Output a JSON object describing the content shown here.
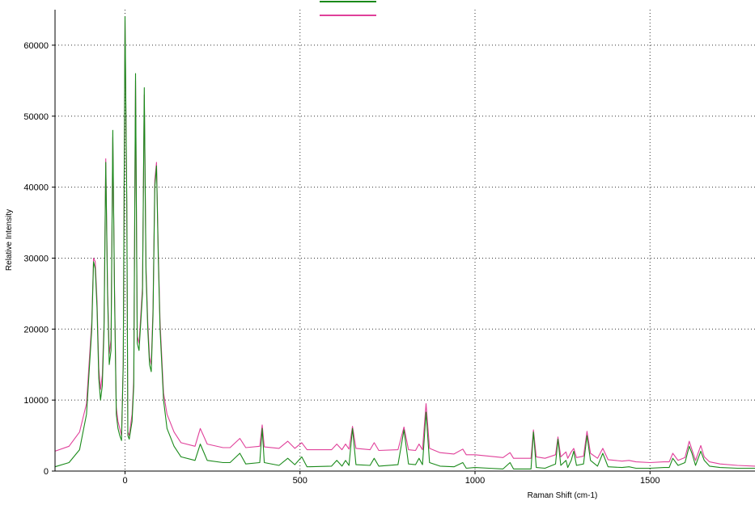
{
  "chart_data": {
    "type": "line",
    "title": "",
    "xlabel": "Raman Shift (cm-1)",
    "ylabel": "Relative Intensity",
    "xlim": [
      -200,
      1800
    ],
    "ylim": [
      0,
      65000
    ],
    "grid": true,
    "grid_style": "dotted",
    "legend_placement": "top-center",
    "x_ticks": [
      0,
      500,
      1000,
      1500
    ],
    "y_ticks": [
      0,
      10000,
      20000,
      30000,
      40000,
      50000,
      60000
    ],
    "series": [
      {
        "color": "#1a8a1a",
        "points": [
          [
            -200,
            600
          ],
          [
            -160,
            1200
          ],
          [
            -130,
            3000
          ],
          [
            -110,
            8000
          ],
          [
            -95,
            20000
          ],
          [
            -90,
            29500
          ],
          [
            -85,
            28500
          ],
          [
            -80,
            23000
          ],
          [
            -75,
            13000
          ],
          [
            -70,
            10000
          ],
          [
            -65,
            12000
          ],
          [
            -60,
            20000
          ],
          [
            -55,
            43500
          ],
          [
            -50,
            25000
          ],
          [
            -45,
            15000
          ],
          [
            -40,
            17000
          ],
          [
            -35,
            48000
          ],
          [
            -30,
            25000
          ],
          [
            -25,
            8000
          ],
          [
            -20,
            6000
          ],
          [
            -15,
            5000
          ],
          [
            -10,
            4300
          ],
          [
            -5,
            15000
          ],
          [
            0,
            64000
          ],
          [
            5,
            38000
          ],
          [
            8,
            5000
          ],
          [
            12,
            4500
          ],
          [
            20,
            7000
          ],
          [
            25,
            12000
          ],
          [
            30,
            56000
          ],
          [
            35,
            18000
          ],
          [
            40,
            17000
          ],
          [
            45,
            21000
          ],
          [
            50,
            25000
          ],
          [
            55,
            54000
          ],
          [
            60,
            28000
          ],
          [
            65,
            20000
          ],
          [
            70,
            15000
          ],
          [
            75,
            14000
          ],
          [
            80,
            22000
          ],
          [
            85,
            40000
          ],
          [
            90,
            43000
          ],
          [
            95,
            30000
          ],
          [
            100,
            20000
          ],
          [
            110,
            10000
          ],
          [
            120,
            6000
          ],
          [
            140,
            3500
          ],
          [
            160,
            2000
          ],
          [
            200,
            1500
          ],
          [
            215,
            3800
          ],
          [
            235,
            1500
          ],
          [
            280,
            1200
          ],
          [
            300,
            1200
          ],
          [
            328,
            2500
          ],
          [
            345,
            1000
          ],
          [
            385,
            1200
          ],
          [
            392,
            6000
          ],
          [
            398,
            1200
          ],
          [
            440,
            800
          ],
          [
            465,
            1800
          ],
          [
            485,
            900
          ],
          [
            505,
            2000
          ],
          [
            520,
            600
          ],
          [
            590,
            700
          ],
          [
            605,
            1500
          ],
          [
            620,
            700
          ],
          [
            630,
            1500
          ],
          [
            640,
            800
          ],
          [
            650,
            6000
          ],
          [
            660,
            900
          ],
          [
            700,
            800
          ],
          [
            712,
            1800
          ],
          [
            725,
            700
          ],
          [
            780,
            900
          ],
          [
            797,
            5800
          ],
          [
            810,
            1000
          ],
          [
            830,
            900
          ],
          [
            840,
            1800
          ],
          [
            850,
            900
          ],
          [
            860,
            8300
          ],
          [
            870,
            1200
          ],
          [
            900,
            700
          ],
          [
            940,
            600
          ],
          [
            965,
            1200
          ],
          [
            975,
            400
          ],
          [
            1000,
            500
          ],
          [
            1040,
            400
          ],
          [
            1080,
            300
          ],
          [
            1100,
            1200
          ],
          [
            1110,
            300
          ],
          [
            1160,
            300
          ],
          [
            1167,
            5500
          ],
          [
            1175,
            500
          ],
          [
            1200,
            400
          ],
          [
            1230,
            1000
          ],
          [
            1237,
            4500
          ],
          [
            1245,
            800
          ],
          [
            1260,
            1500
          ],
          [
            1265,
            500
          ],
          [
            1275,
            1500
          ],
          [
            1282,
            2800
          ],
          [
            1290,
            800
          ],
          [
            1310,
            1000
          ],
          [
            1320,
            5000
          ],
          [
            1330,
            1500
          ],
          [
            1350,
            700
          ],
          [
            1365,
            2500
          ],
          [
            1380,
            600
          ],
          [
            1420,
            500
          ],
          [
            1440,
            600
          ],
          [
            1460,
            400
          ],
          [
            1500,
            400
          ],
          [
            1540,
            500
          ],
          [
            1555,
            500
          ],
          [
            1565,
            1800
          ],
          [
            1580,
            800
          ],
          [
            1600,
            1200
          ],
          [
            1612,
            3500
          ],
          [
            1620,
            2500
          ],
          [
            1630,
            800
          ],
          [
            1645,
            2800
          ],
          [
            1655,
            1500
          ],
          [
            1670,
            700
          ],
          [
            1700,
            500
          ],
          [
            1750,
            400
          ],
          [
            1800,
            400
          ]
        ]
      },
      {
        "color": "#e0409a",
        "points": [
          [
            -200,
            2800
          ],
          [
            -160,
            3500
          ],
          [
            -130,
            5500
          ],
          [
            -110,
            9500
          ],
          [
            -95,
            21000
          ],
          [
            -90,
            30000
          ],
          [
            -85,
            29500
          ],
          [
            -80,
            24000
          ],
          [
            -75,
            14500
          ],
          [
            -70,
            11500
          ],
          [
            -65,
            13500
          ],
          [
            -60,
            21000
          ],
          [
            -55,
            44000
          ],
          [
            -50,
            26000
          ],
          [
            -45,
            16500
          ],
          [
            -40,
            18500
          ],
          [
            -35,
            47000
          ],
          [
            -30,
            26000
          ],
          [
            -25,
            9000
          ],
          [
            -20,
            7000
          ],
          [
            -15,
            6000
          ],
          [
            -10,
            5000
          ],
          [
            -5,
            15500
          ],
          [
            0,
            63500
          ],
          [
            5,
            37000
          ],
          [
            8,
            5500
          ],
          [
            12,
            5000
          ],
          [
            20,
            8000
          ],
          [
            25,
            13000
          ],
          [
            30,
            55000
          ],
          [
            35,
            19000
          ],
          [
            40,
            18000
          ],
          [
            45,
            22000
          ],
          [
            50,
            26000
          ],
          [
            55,
            53000
          ],
          [
            60,
            29000
          ],
          [
            65,
            21000
          ],
          [
            70,
            16000
          ],
          [
            75,
            15000
          ],
          [
            80,
            23000
          ],
          [
            85,
            41000
          ],
          [
            90,
            43500
          ],
          [
            95,
            31000
          ],
          [
            100,
            21000
          ],
          [
            110,
            11000
          ],
          [
            120,
            8000
          ],
          [
            140,
            5500
          ],
          [
            160,
            4000
          ],
          [
            200,
            3500
          ],
          [
            215,
            6000
          ],
          [
            235,
            3800
          ],
          [
            280,
            3300
          ],
          [
            300,
            3300
          ],
          [
            328,
            4600
          ],
          [
            345,
            3300
          ],
          [
            385,
            3500
          ],
          [
            392,
            6500
          ],
          [
            398,
            3400
          ],
          [
            440,
            3200
          ],
          [
            465,
            4200
          ],
          [
            485,
            3200
          ],
          [
            505,
            4000
          ],
          [
            520,
            3000
          ],
          [
            590,
            3000
          ],
          [
            605,
            3800
          ],
          [
            620,
            3000
          ],
          [
            630,
            3800
          ],
          [
            640,
            3100
          ],
          [
            650,
            6300
          ],
          [
            660,
            3200
          ],
          [
            700,
            3000
          ],
          [
            712,
            4000
          ],
          [
            725,
            2900
          ],
          [
            780,
            3000
          ],
          [
            797,
            6200
          ],
          [
            810,
            3000
          ],
          [
            830,
            2900
          ],
          [
            840,
            3800
          ],
          [
            850,
            3000
          ],
          [
            860,
            9500
          ],
          [
            870,
            3200
          ],
          [
            900,
            2600
          ],
          [
            940,
            2400
          ],
          [
            965,
            3100
          ],
          [
            975,
            2300
          ],
          [
            1000,
            2300
          ],
          [
            1040,
            2100
          ],
          [
            1080,
            1900
          ],
          [
            1100,
            2600
          ],
          [
            1110,
            1800
          ],
          [
            1160,
            1800
          ],
          [
            1167,
            5800
          ],
          [
            1175,
            2000
          ],
          [
            1200,
            1800
          ],
          [
            1230,
            2300
          ],
          [
            1237,
            4800
          ],
          [
            1245,
            2000
          ],
          [
            1260,
            2700
          ],
          [
            1265,
            1800
          ],
          [
            1275,
            2700
          ],
          [
            1282,
            3200
          ],
          [
            1290,
            1900
          ],
          [
            1310,
            2100
          ],
          [
            1320,
            5600
          ],
          [
            1330,
            2500
          ],
          [
            1350,
            1800
          ],
          [
            1365,
            3200
          ],
          [
            1380,
            1600
          ],
          [
            1420,
            1400
          ],
          [
            1440,
            1500
          ],
          [
            1460,
            1300
          ],
          [
            1500,
            1200
          ],
          [
            1540,
            1300
          ],
          [
            1555,
            1300
          ],
          [
            1565,
            2500
          ],
          [
            1580,
            1500
          ],
          [
            1600,
            1900
          ],
          [
            1612,
            4200
          ],
          [
            1620,
            3000
          ],
          [
            1630,
            1500
          ],
          [
            1645,
            3600
          ],
          [
            1655,
            2000
          ],
          [
            1670,
            1300
          ],
          [
            1700,
            1000
          ],
          [
            1750,
            800
          ],
          [
            1800,
            700
          ]
        ]
      }
    ]
  }
}
